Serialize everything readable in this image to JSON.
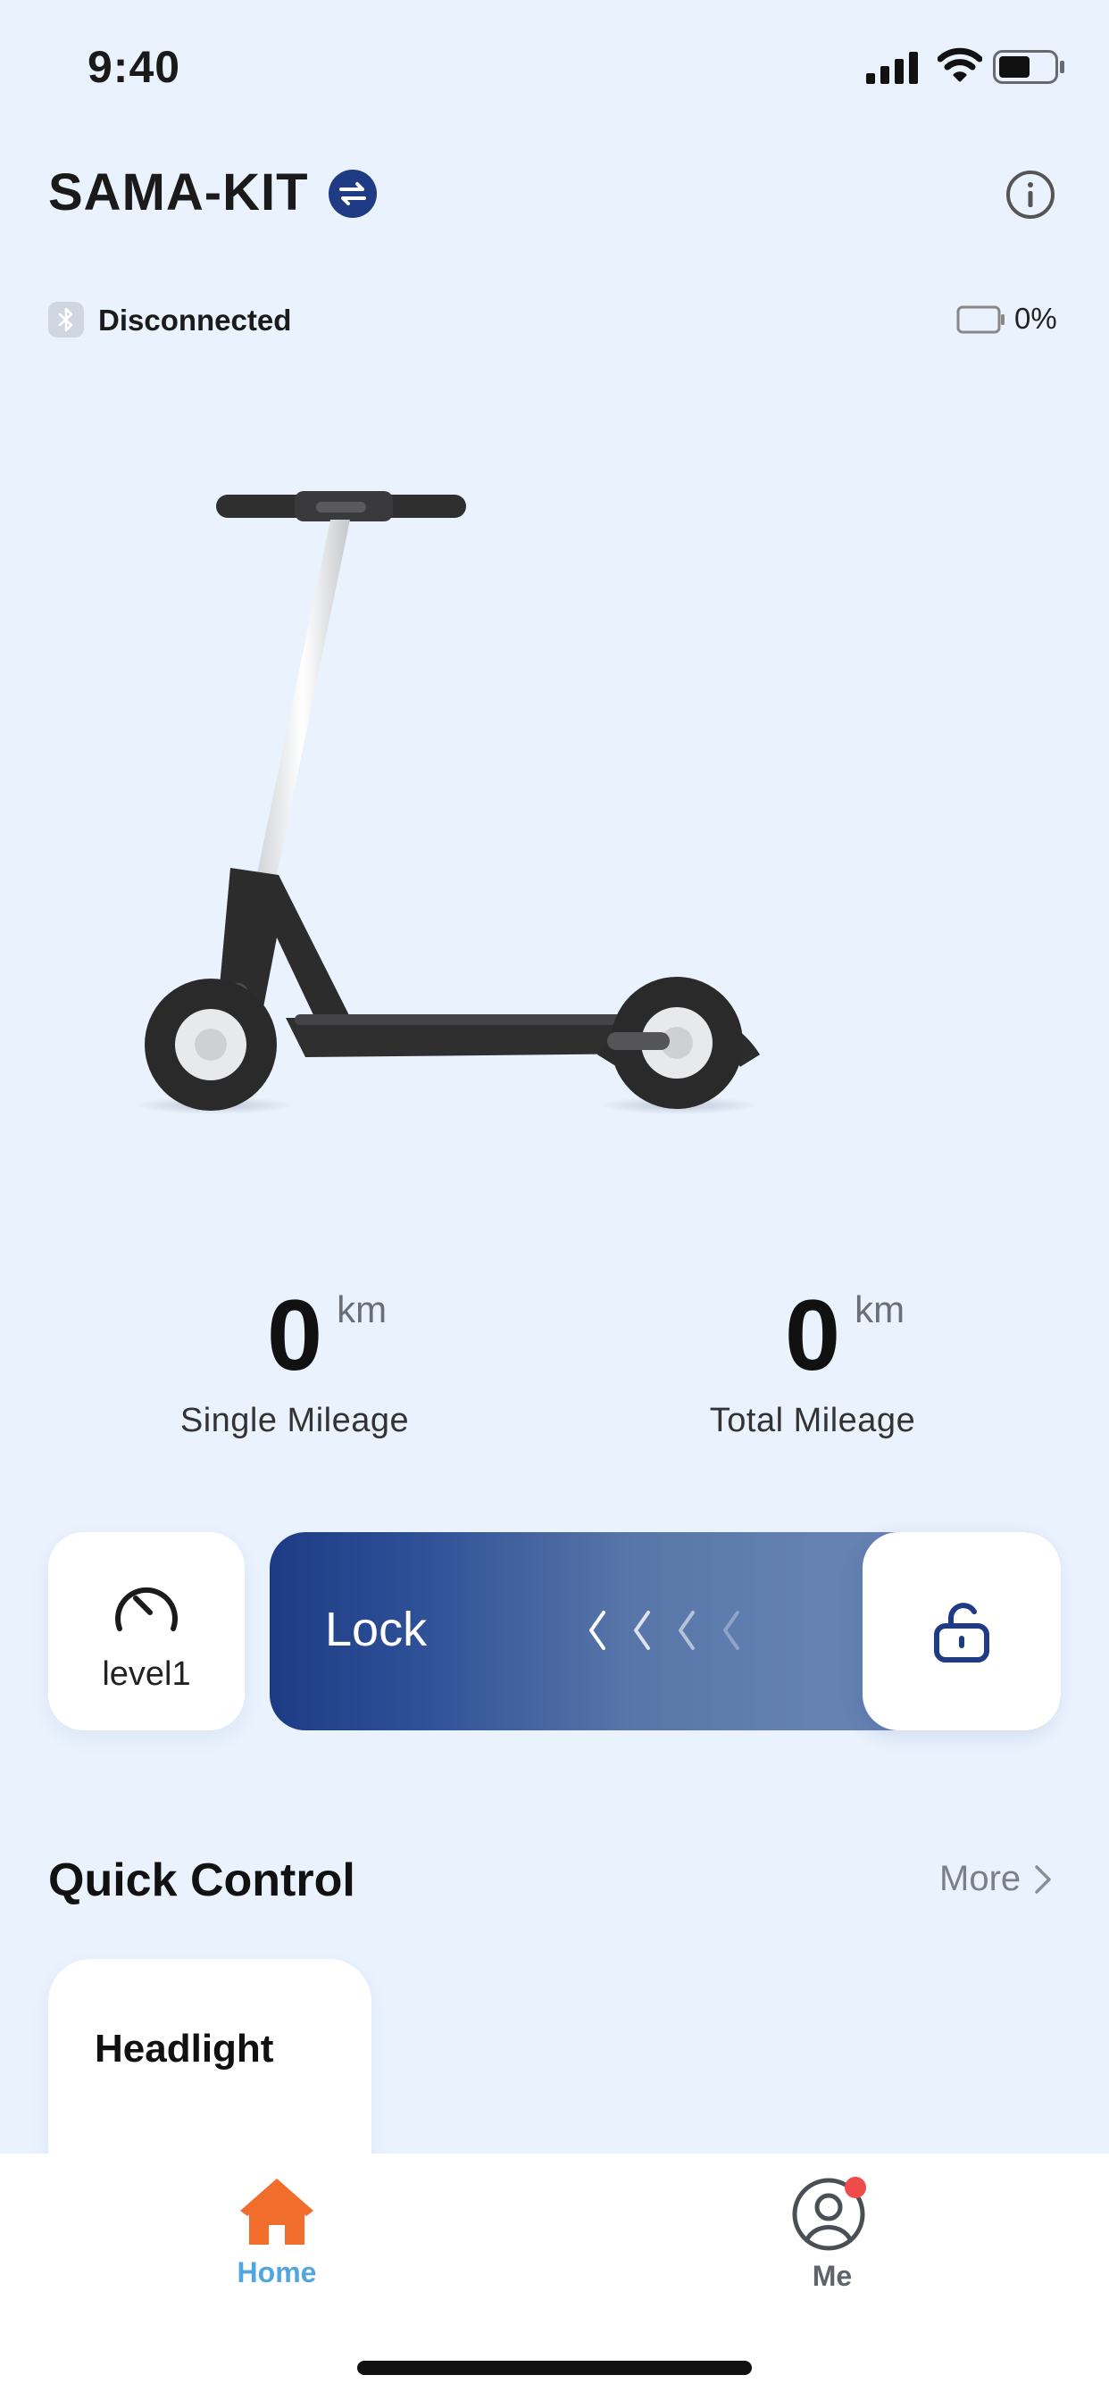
{
  "status_bar": {
    "time": "9:40"
  },
  "header": {
    "title": "SAMA-KIT"
  },
  "connection": {
    "status": "Disconnected",
    "battery_percent": "0%"
  },
  "mileage": {
    "single": {
      "value": "0",
      "unit": "km",
      "label": "Single Mileage"
    },
    "total": {
      "value": "0",
      "unit": "km",
      "label": "Total Mileage"
    }
  },
  "speed_level": {
    "label": "level1"
  },
  "lock_slider": {
    "label": "Lock"
  },
  "quick_control": {
    "title": "Quick Control",
    "more_label": "More",
    "items": [
      {
        "label": "Headlight"
      }
    ]
  },
  "tabbar": {
    "tabs": [
      {
        "label": "Home",
        "active": true
      },
      {
        "label": "Me",
        "active": false,
        "badge": true
      }
    ]
  },
  "colors": {
    "background": "#e9f2fd",
    "accent_navy": "#1e3b84",
    "home_orange": "#f06d2c",
    "active_tab_blue": "#52a6df",
    "badge_red": "#ee4b4b"
  },
  "icons": [
    "signal-icon",
    "wifi-icon",
    "battery-icon",
    "switch-icon",
    "info-icon",
    "bluetooth-icon",
    "battery-outline-icon",
    "speedometer-icon",
    "chevron-left-icon",
    "unlock-icon",
    "chevron-right-icon",
    "home-icon",
    "user-icon"
  ]
}
